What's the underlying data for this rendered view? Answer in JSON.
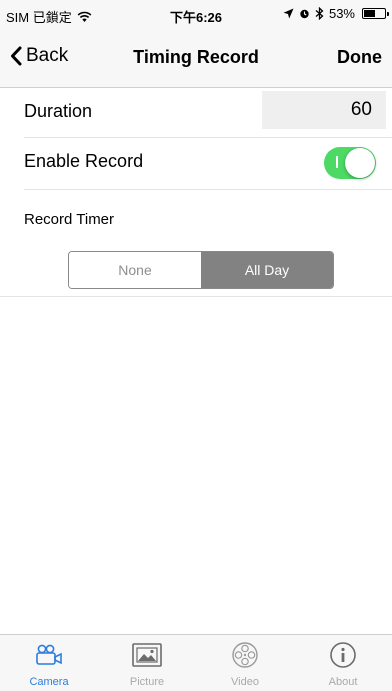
{
  "status_bar": {
    "carrier": "SIM 已鎖定",
    "time": "下午6:26",
    "battery_percent": "53%",
    "battery_level": 0.53
  },
  "nav": {
    "back_label": "Back",
    "title": "Timing Record",
    "done_label": "Done"
  },
  "settings": {
    "duration_label": "Duration",
    "duration_value": "60",
    "enable_record_label": "Enable Record",
    "enable_record_on": true,
    "record_timer_label": "Record Timer",
    "timer_options": [
      "None",
      "All Day"
    ],
    "timer_selected": "All Day"
  },
  "tab_bar": {
    "tabs": [
      {
        "label": "Camera",
        "icon": "camera-icon",
        "active": true
      },
      {
        "label": "Picture",
        "icon": "picture-icon",
        "active": false
      },
      {
        "label": "Video",
        "icon": "video-icon",
        "active": false
      },
      {
        "label": "About",
        "icon": "info-icon",
        "active": false
      }
    ]
  },
  "colors": {
    "accent": "#2d7ddf",
    "toggle_on": "#4cd964",
    "segment_selected": "#828282",
    "inactive_tab": "#a9a9a9"
  }
}
